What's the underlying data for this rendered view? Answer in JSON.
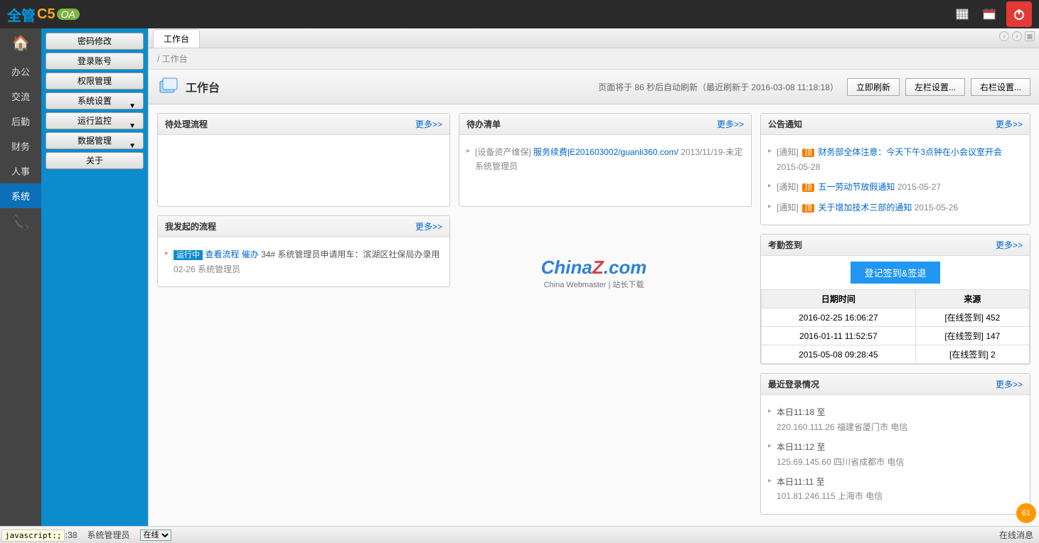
{
  "logo": {
    "t1": "全管",
    "t2": "C5",
    "t3": "OA"
  },
  "nav": [
    {
      "icon": "home",
      "text": ""
    },
    {
      "text": "办公"
    },
    {
      "text": "交流"
    },
    {
      "text": "后勤"
    },
    {
      "text": "财务"
    },
    {
      "text": "人事"
    },
    {
      "text": "系统",
      "active": true
    }
  ],
  "subnav": [
    {
      "label": "密码修改"
    },
    {
      "label": "登录账号"
    },
    {
      "label": "权限管理"
    },
    {
      "label": "系统设置",
      "dd": true
    },
    {
      "label": "运行监控",
      "dd": true
    },
    {
      "label": "数据管理",
      "dd": true
    },
    {
      "label": "关于"
    }
  ],
  "tab": "工作台",
  "breadcrumb": "/ 工作台",
  "page_title": "工作台",
  "refresh_info": "页面将于 86 秒后自动刷新（最近刷新于 2016-03-08 11:18:18）",
  "btns": {
    "refresh": "立即刷新",
    "leftset": "左栏设置...",
    "rightset": "右栏设置..."
  },
  "more": "更多>>",
  "panels": {
    "pending": {
      "title": "待处理流程"
    },
    "myflow": {
      "title": "我发起的流程",
      "items": [
        {
          "status": "运行中",
          "view": "查看流程",
          "urge": "催办",
          "desc": "34# 系统管理员申请用车：滨湖区社保局办录用",
          "date": "02-26",
          "user": "系统管理员"
        }
      ]
    },
    "todo": {
      "title": "待办清单",
      "items": [
        {
          "cat": "[设备资产维保]",
          "link": "服务续费|E201603002/guanli360.com/",
          "tail": "2013/11/19-未定",
          "user": "系统管理员"
        }
      ]
    },
    "notice": {
      "title": "公告通知",
      "items": [
        {
          "tag": "[通知]",
          "badge": "顶",
          "link": "财务部全体注意：今天下午3点钟在小会议室开会",
          "date": "2015-05-28"
        },
        {
          "tag": "[通知]",
          "badge": "顶",
          "link": "五一劳动节放假通知",
          "date": "2015-05-27"
        },
        {
          "tag": "[通知]",
          "badge": "顶",
          "link": "关于增加技术三部的通知",
          "date": "2015-05-26"
        }
      ]
    },
    "attendance": {
      "title": "考勤签到",
      "btn": "登记签到&签退",
      "cols": [
        "日期时间",
        "来源"
      ],
      "rows": [
        {
          "dt": "2016-02-25 16:06:27",
          "src": "[在线签到] 452"
        },
        {
          "dt": "2016-01-11 11:52:57",
          "src": "[在线签到] 147"
        },
        {
          "dt": "2015-05-08 09:28:45",
          "src": "[在线签到] 2"
        }
      ]
    },
    "logins": {
      "title": "最近登录情况",
      "items": [
        {
          "head": "本日11:18 至",
          "detail": "220.160.111.26 福建省厦门市 电信"
        },
        {
          "head": "本日11:12 至",
          "detail": "125.69.145.60 四川省成都市 电信"
        },
        {
          "head": "本日11:11 至",
          "detail": "101.81.246.115 上海市 电信"
        }
      ]
    }
  },
  "watermark": {
    "main1": "China",
    "main2": "Z",
    "main3": ".com",
    "sub": "China Webmaster | 站长下载"
  },
  "status": {
    "date": "日 星期二 11:18:38",
    "user": "系统管理员",
    "online": "在线",
    "right": "在线消息"
  },
  "jshint": "javascript:;",
  "badge": "61"
}
